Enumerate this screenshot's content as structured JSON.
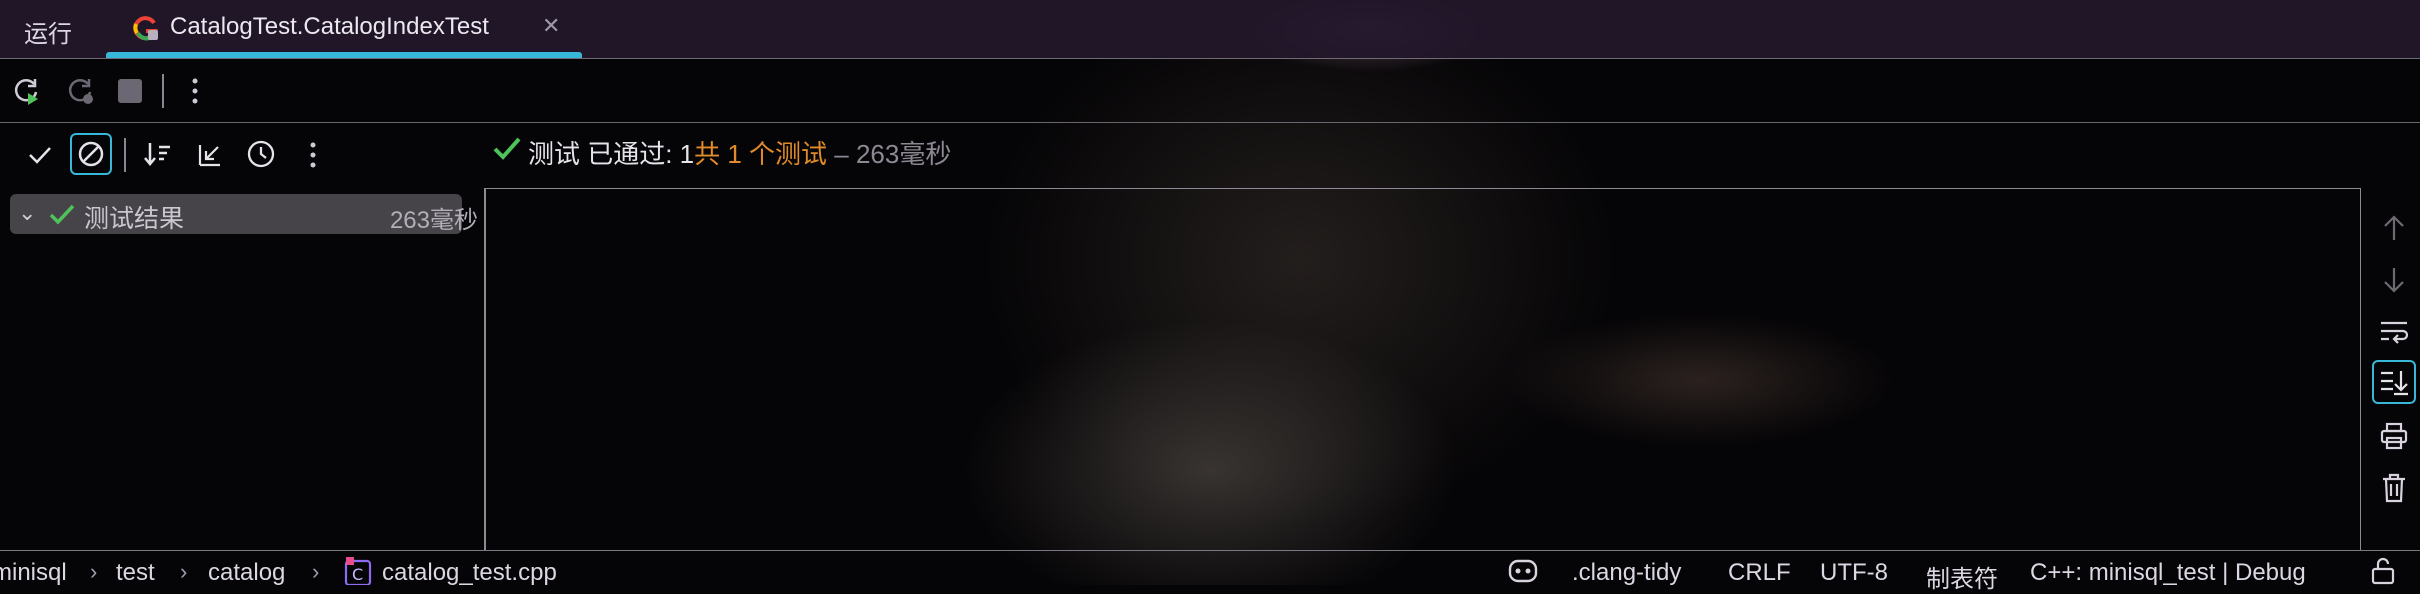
{
  "tabs": {
    "run_label": "运行",
    "active_tab_label": "CatalogTest.CatalogIndexTest"
  },
  "results": {
    "status_prefix": "测试 已通过: 1",
    "status_total": "共 1 个测试",
    "status_time": " – 263毫秒",
    "tree_root_label": "测试结果",
    "tree_root_time": "263毫秒"
  },
  "statusbar": {
    "breadcrumb": [
      "minisql",
      "test",
      "catalog",
      "catalog_test.cpp"
    ],
    "clang_tidy": ".clang-tidy",
    "line_ending": "CRLF",
    "encoding": "UTF-8",
    "indent": "制表符",
    "config": "C++: minisql_test | Debug"
  },
  "colors": {
    "accent": "#38b8d8",
    "pass_green": "#4fc25a",
    "total_orange": "#e08a2a"
  },
  "icons": [
    "rerun-icon",
    "rerun-failed-icon",
    "stop-icon",
    "more-icon",
    "show-passed-icon",
    "show-ignored-icon",
    "sort-icon",
    "collapse-icon",
    "history-icon",
    "up-icon",
    "down-icon",
    "soft-wrap-icon",
    "scroll-to-end-icon",
    "print-icon",
    "trash-icon",
    "ai-assistant-icon",
    "lock-icon"
  ]
}
